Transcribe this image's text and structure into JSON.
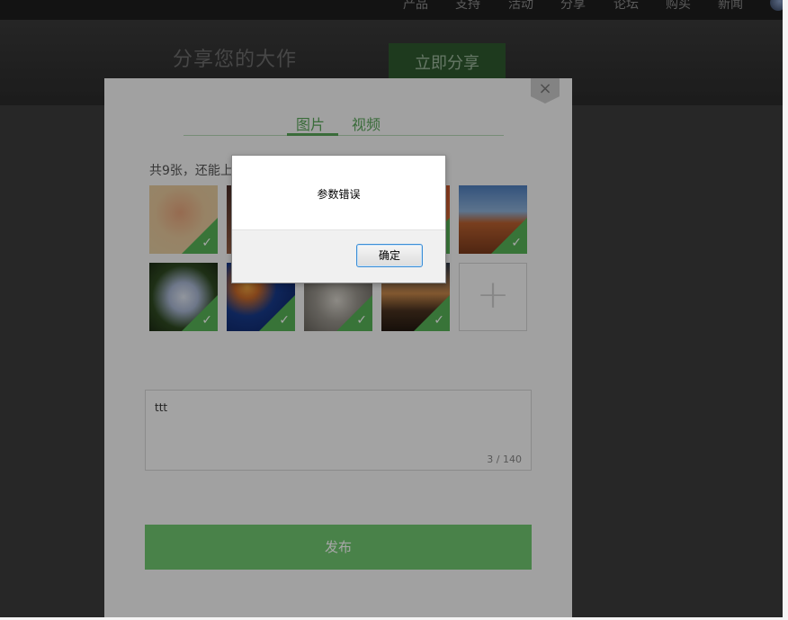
{
  "nav": {
    "items": [
      "产品",
      "支持",
      "活动",
      "分享",
      "论坛",
      "购买",
      "新闻"
    ]
  },
  "hero": {
    "heading": "分享您的大作",
    "share_button": "立即分享"
  },
  "share_modal": {
    "close_icon": "×",
    "tabs": [
      "图片",
      "视频"
    ],
    "active_tab": "图片",
    "image_count_text": "共9张，还能上",
    "add_photo_icon": "+",
    "check_icon": "✓",
    "description_value": "ttt",
    "char_counter": "3 / 140",
    "publish_button": "发布",
    "accent_color": "#5aa65a"
  },
  "alert": {
    "message": "参数错误",
    "ok_button": "确定"
  }
}
